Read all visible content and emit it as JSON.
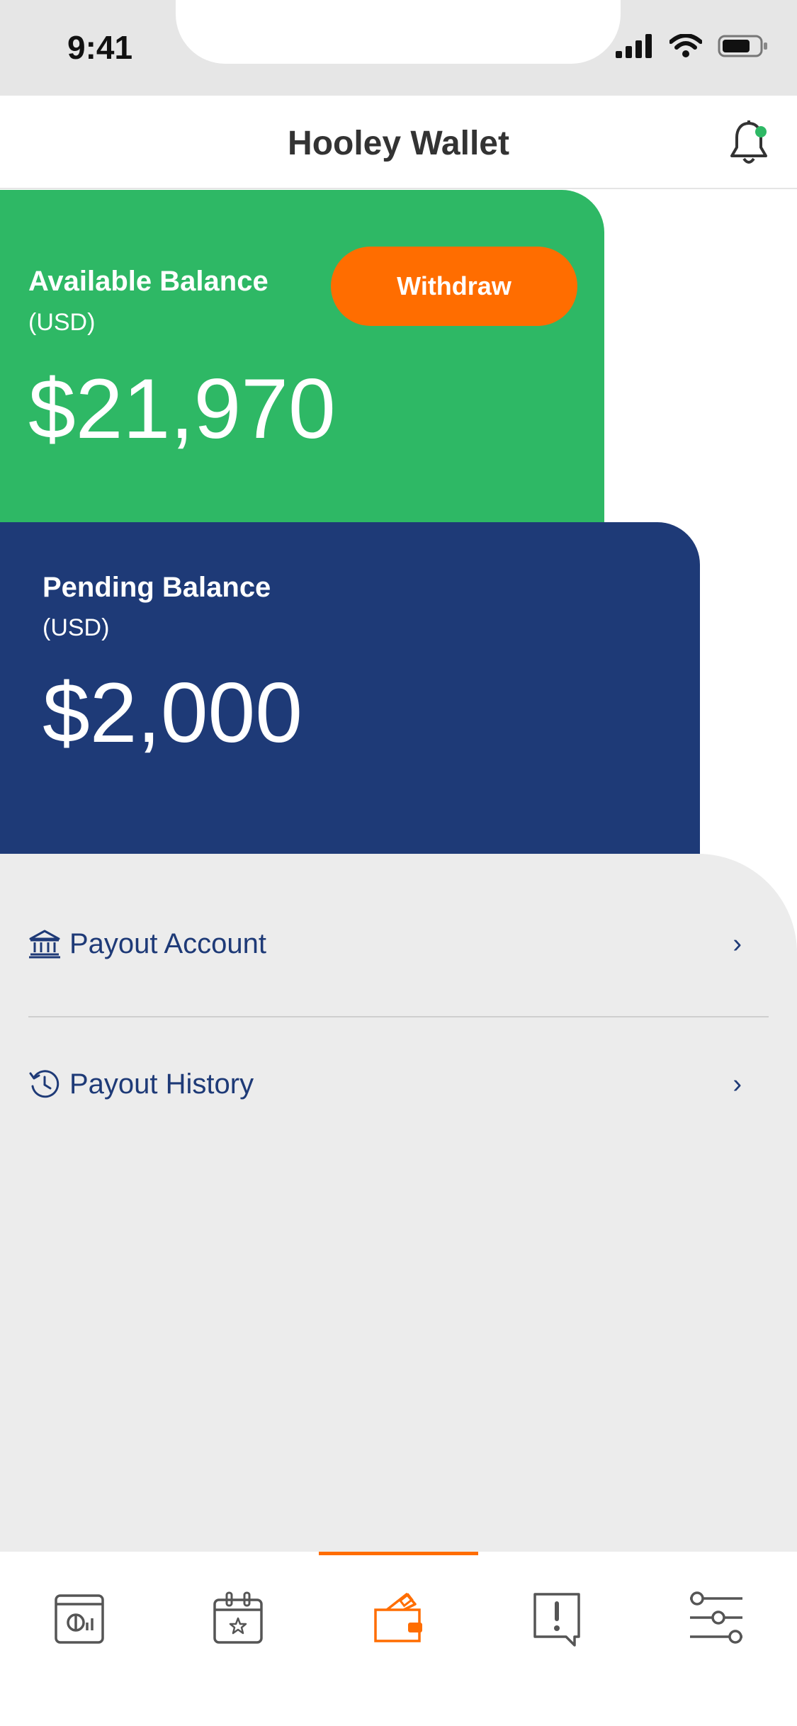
{
  "status_bar": {
    "time": "9:41",
    "icons": [
      "signal-icon",
      "wifi-icon",
      "battery-icon"
    ]
  },
  "header": {
    "title": "Hooley Wallet",
    "notification_icon": "bell-icon",
    "notification_dot_color": "#2eb865"
  },
  "available_card": {
    "label": "Available Balance",
    "unit": "(USD)",
    "amount": "$21,970",
    "button_label": "Withdraw",
    "bg_color": "#2eb865",
    "button_color": "#ff6d00"
  },
  "pending_card": {
    "label": "Pending Balance",
    "unit": "(USD)",
    "amount": "$2,000",
    "bg_color": "#1e3a77"
  },
  "menu": {
    "items": [
      {
        "label": "Payout Account",
        "icon": "bank-icon",
        "chevron": "›"
      },
      {
        "label": "Payout History",
        "icon": "history-icon",
        "chevron": "›"
      }
    ]
  },
  "tab_bar": {
    "active_index": 2,
    "active_color": "#ff6d00",
    "tabs": [
      {
        "icon": "dashboard-icon"
      },
      {
        "icon": "calendar-icon"
      },
      {
        "icon": "wallet-icon"
      },
      {
        "icon": "alert-message-icon"
      },
      {
        "icon": "sliders-icon"
      }
    ]
  }
}
